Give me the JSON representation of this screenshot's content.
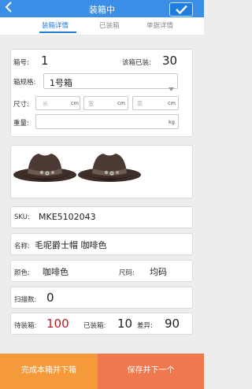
{
  "header": {
    "title": "装箱中"
  },
  "tabs": [
    {
      "label": "装箱详情"
    },
    {
      "label": "已装箱"
    },
    {
      "label": "单据详情"
    }
  ],
  "box_info": {
    "box_no_label": "箱号:",
    "box_no_value": "1",
    "packed_label": "该箱已装:",
    "packed_value": "30",
    "spec_label": "箱规格:",
    "spec_value": "1号箱",
    "size_label": "尺寸:",
    "length_placeholder": "长",
    "width_placeholder": "宽",
    "height_placeholder": "高",
    "size_unit": "cm",
    "weight_label": "重量:",
    "weight_unit": "kg"
  },
  "product": {
    "sku_label": "SKU:",
    "sku_value": "MKE5102043",
    "name_label": "名称:",
    "name_value": "毛呢爵士帽 咖啡色",
    "color_label": "颜色:",
    "color_value": "咖啡色",
    "size_label": "尺码:",
    "size_value": "均码"
  },
  "scan": {
    "label": "扫描数:",
    "value": "0"
  },
  "summary": {
    "pending_label": "待装箱:",
    "pending_value": "100",
    "packed_label": "已装箱:",
    "packed_value": "10",
    "diff_label": "差异:",
    "diff_value": "90"
  },
  "actions": {
    "finish_label": "完成本箱并下箱",
    "save_label": "保存并下一个"
  },
  "colors": {
    "header_blue": "#3a8ee6",
    "accent_blue": "#1f7de0",
    "finish_orange": "#f59a3a",
    "save_orange": "#f0784f",
    "pending_red": "#c41a1a"
  }
}
